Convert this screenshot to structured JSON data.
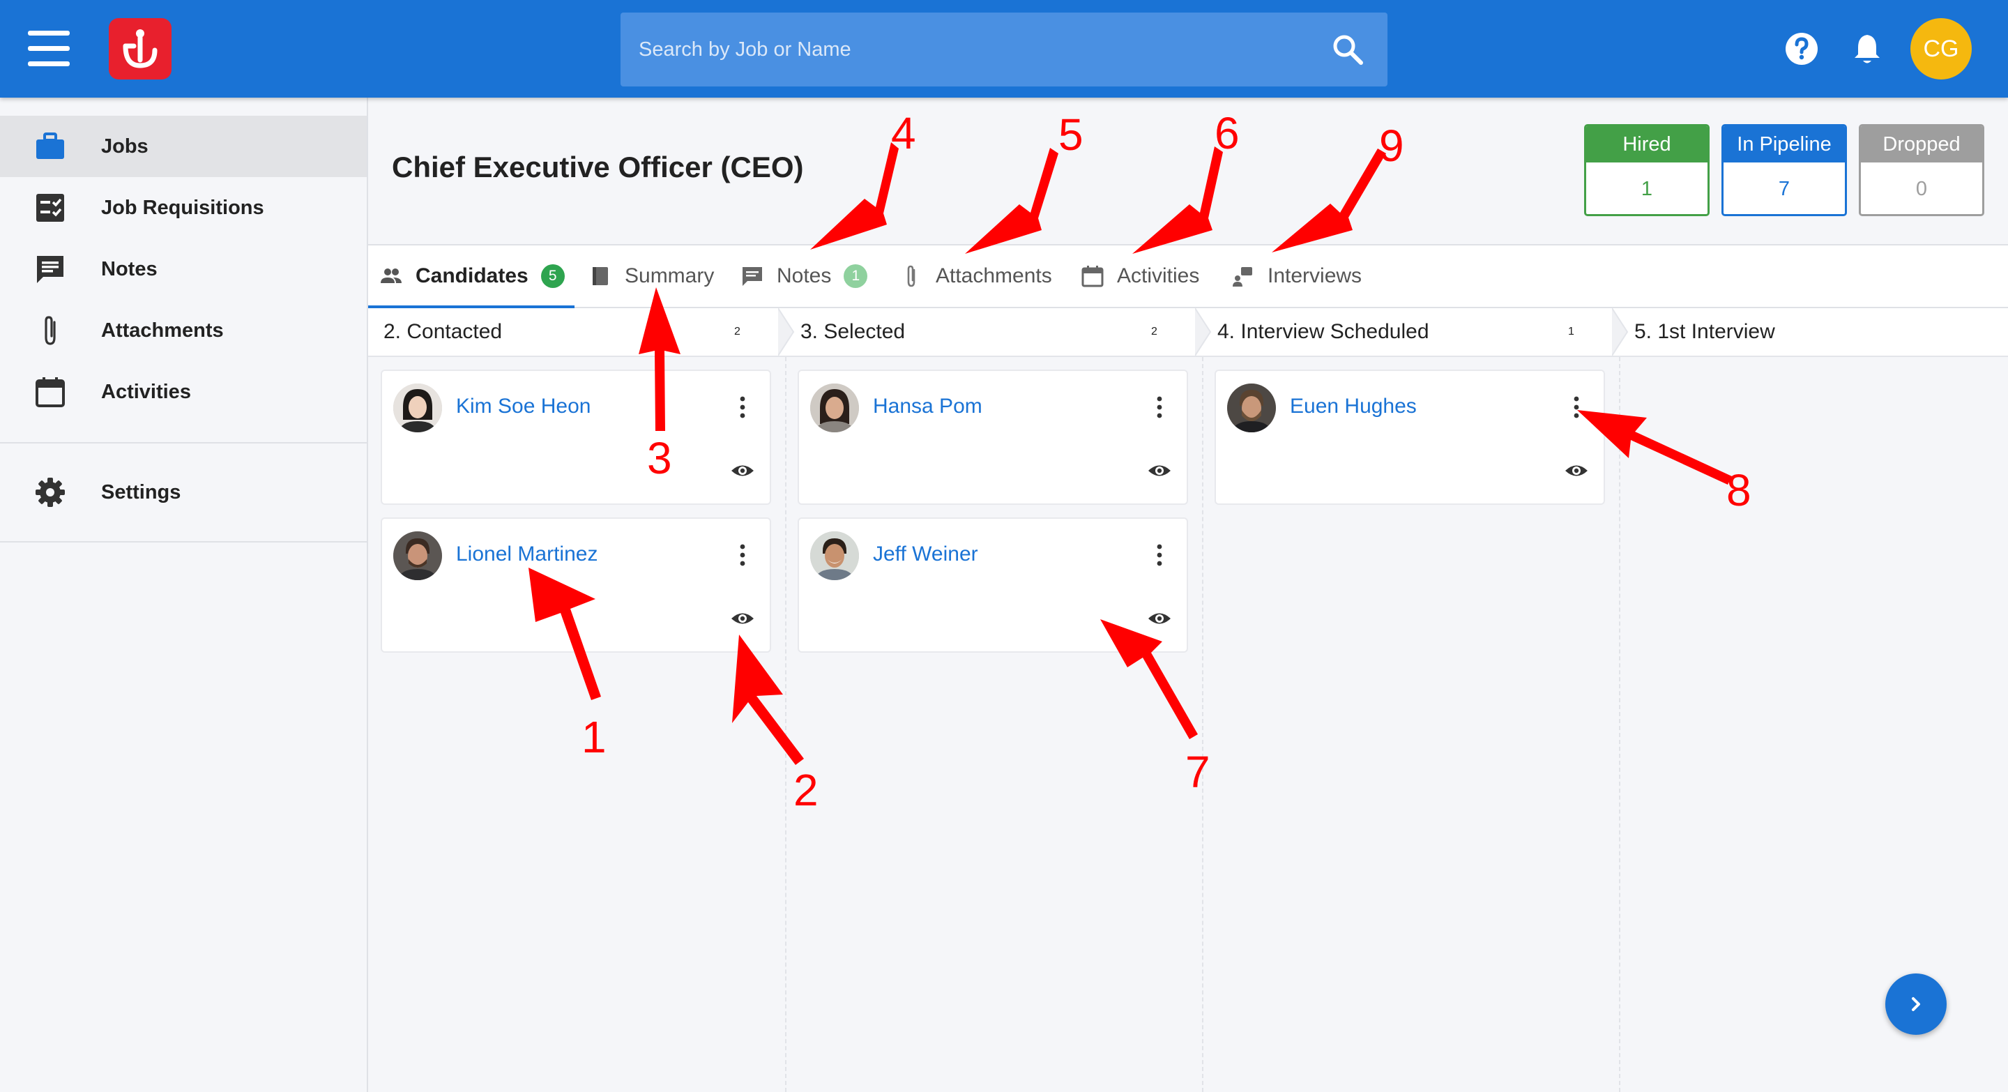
{
  "header": {
    "search_placeholder": "Search by Job or Name",
    "user_initials": "CG"
  },
  "sidebar": {
    "items": [
      {
        "label": "Jobs",
        "icon": "briefcase-icon",
        "active": true
      },
      {
        "label": "Job Requisitions",
        "icon": "checklist-icon"
      },
      {
        "label": "Notes",
        "icon": "comment-icon"
      },
      {
        "label": "Attachments",
        "icon": "paperclip-icon"
      },
      {
        "label": "Activities",
        "icon": "calendar-icon"
      }
    ],
    "settings_label": "Settings"
  },
  "job": {
    "title": "Chief Executive Officer (CEO)"
  },
  "stats": [
    {
      "label": "Hired",
      "value": "1",
      "color": "#43a047"
    },
    {
      "label": "In Pipeline",
      "value": "7",
      "color": "#1a73d5"
    },
    {
      "label": "Dropped",
      "value": "0",
      "color": "#9e9e9e"
    }
  ],
  "tabs": [
    {
      "label": "Candidates",
      "badge": "5",
      "active": true
    },
    {
      "label": "Summary"
    },
    {
      "label": "Notes",
      "badge": "1"
    },
    {
      "label": "Attachments"
    },
    {
      "label": "Activities"
    },
    {
      "label": "Interviews"
    }
  ],
  "stages": [
    {
      "label": "2. Contacted",
      "count": "2"
    },
    {
      "label": "3. Selected",
      "count": "2"
    },
    {
      "label": "4. Interview Scheduled",
      "count": "1"
    },
    {
      "label": "5. 1st Interview"
    }
  ],
  "cards": [
    {
      "name": "Kim Soe Heon",
      "stage": "2. Contacted"
    },
    {
      "name": "Lionel Martinez",
      "stage": "2. Contacted"
    },
    {
      "name": "Hansa Pom",
      "stage": "3. Selected"
    },
    {
      "name": "Jeff Weiner",
      "stage": "3. Selected"
    },
    {
      "name": "Euen Hughes",
      "stage": "4. Interview Scheduled"
    }
  ],
  "annotations": [
    "1",
    "2",
    "3",
    "4",
    "5",
    "6",
    "7",
    "8",
    "9"
  ],
  "colors": {
    "primary": "#1a73d5",
    "logo": "#e8202d",
    "avatar": "#f5b80f",
    "badge": "#2ea44f",
    "annotation": "#ff0000"
  }
}
